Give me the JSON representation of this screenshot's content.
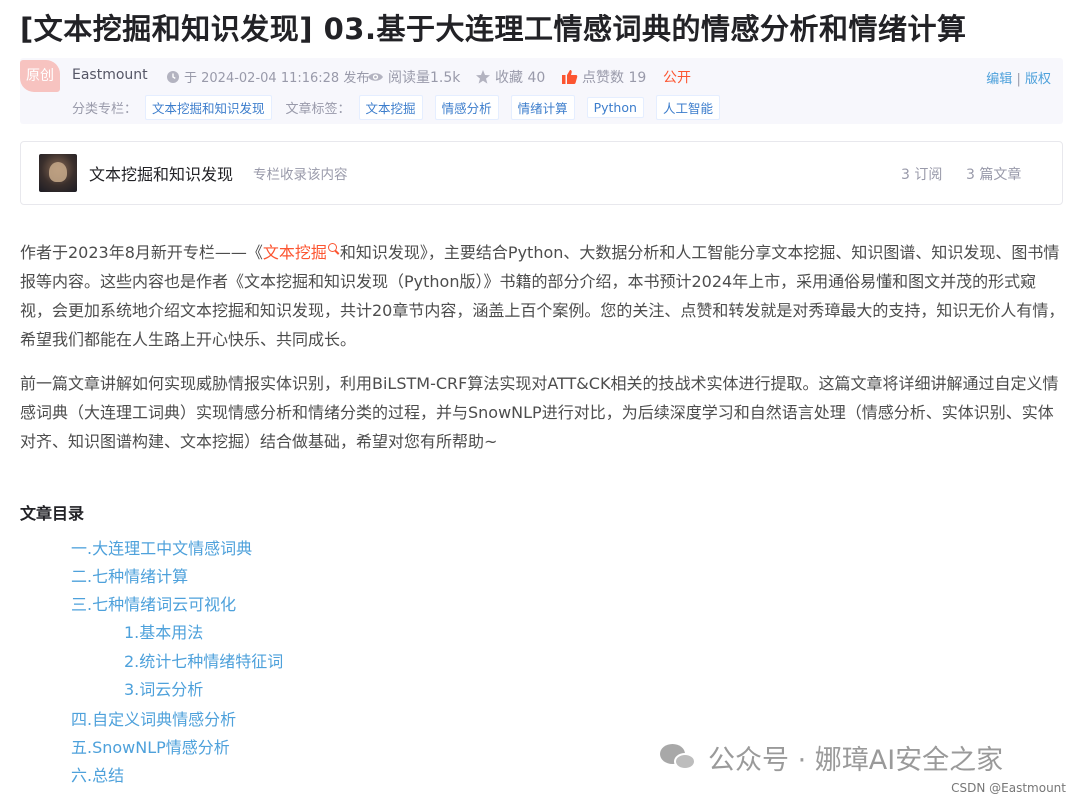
{
  "article": {
    "title": "[文本挖掘和知识发现] 03.基于大连理工情感词典的情感分析和情绪计算"
  },
  "meta": {
    "original_badge": "原创",
    "author": "Eastmount",
    "published": "于 2024-02-04 11:16:28 发布",
    "reads": "阅读量1.5k",
    "favorites": "收藏 40",
    "likes": "点赞数 19",
    "visibility": "公开",
    "edit_label": "编辑",
    "separator": "|",
    "copyright_label": "版权",
    "category_label": "分类专栏：",
    "categories": [
      "文本挖掘和知识发现"
    ],
    "tags_label": "文章标签：",
    "tags": [
      "文本挖掘",
      "情感分析",
      "情绪计算",
      "Python",
      "人工智能"
    ],
    "icons": {
      "time": "clock-icon",
      "reads": "eye-icon",
      "favorites": "star-icon",
      "likes": "thumbs-up-icon"
    },
    "colors": {
      "accent": "#fc5531",
      "link": "#4ea1db",
      "tag_text": "#3c7dcc"
    }
  },
  "column": {
    "name": "文本挖掘和知识发现",
    "description": "专栏收录该内容",
    "subscriptions": "3 订阅",
    "articles": "3 篇文章"
  },
  "intro": {
    "p1_prefix": "作者于2023年8月新开专栏——《",
    "p1_highlight": "文本挖掘",
    "p1_suffix": "和知识发现》，主要结合Python、大数据分析和人工智能分享文本挖掘、知识图谱、知识发现、图书情报等内容。这些内容也是作者《文本挖掘和知识发现（Python版）》书籍的部分介绍，本书预计2024年上市，采用通俗易懂和图文并茂的形式窥视，会更加系统地介绍文本挖掘和知识发现，共计20章节内容，涵盖上百个案例。您的关注、点赞和转发就是对秀璋最大的支持，知识无价人有情，希望我们都能在人生路上开心快乐、共同成长。",
    "p2": "前一篇文章讲解如何实现威胁情报实体识别，利用BiLSTM-CRF算法实现对ATT&CK相关的技战术实体进行提取。这篇文章将详细讲解通过自定义情感词典（大连理工词典）实现情感分析和情绪分类的过程，并与SnowNLP进行对比，为后续深度学习和自然语言处理（情感分析、实体识别、实体对齐、知识图谱构建、文本挖掘）结合做基础，希望对您有所帮助~"
  },
  "toc": {
    "title": "文章目录",
    "items": [
      "一.大连理工中文情感词典",
      "二.七种情绪计算",
      "三.七种情绪词云可视化",
      "1.基本用法",
      "2.统计七种情绪特征词",
      "3.词云分析",
      "四.自定义词典情感分析",
      "五.SnowNLP情感分析",
      "六.总结"
    ]
  },
  "watermark": {
    "text": "公众号 · 娜璋AI安全之家",
    "icon": "wechat-icon"
  },
  "credit": "CSDN @Eastmount"
}
